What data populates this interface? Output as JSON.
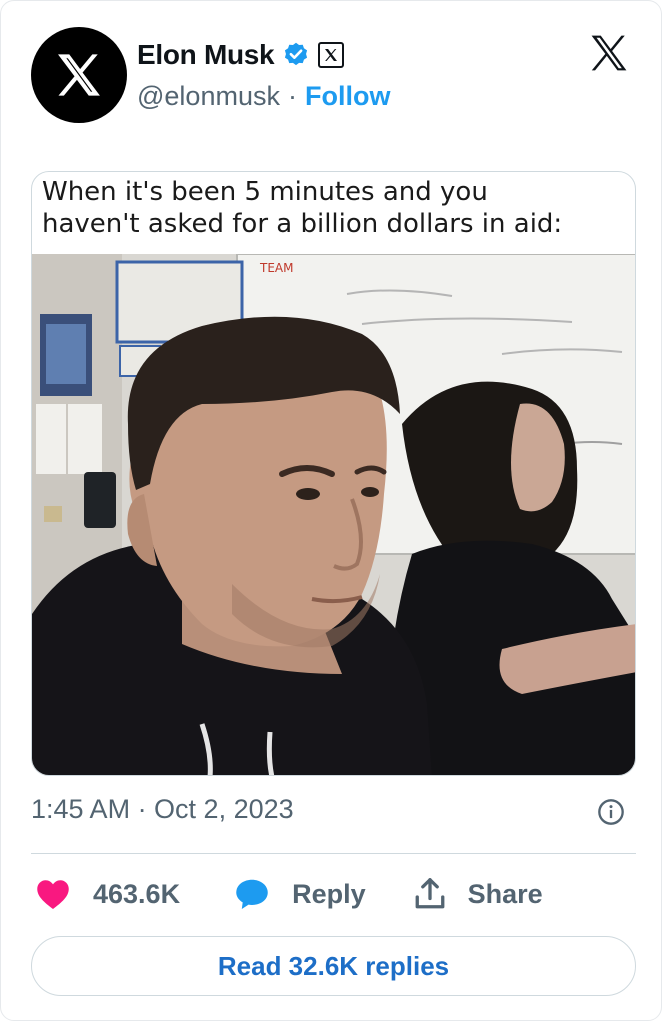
{
  "author": {
    "name": "Elon Musk",
    "handle": "@elonmusk",
    "separator": "·",
    "follow_label": "Follow",
    "avatar_icon": "x-logo-icon",
    "verified_icon": "verified-badge-icon",
    "affiliation_icon": "x-affiliation-icon"
  },
  "header": {
    "platform_icon": "x-logo-icon"
  },
  "media": {
    "caption_line1": "When it's been 5 minutes and you",
    "caption_line2": "haven't asked for a billion dollars in aid:",
    "image": "meme-photo"
  },
  "meta": {
    "timestamp": "1:45 AM · Oct 2, 2023",
    "info_icon": "info-icon"
  },
  "actions": {
    "like_count": "463.6K",
    "reply_label": "Reply",
    "share_label": "Share"
  },
  "read_replies_label": "Read 32.6K replies",
  "colors": {
    "accent": "#1d9bf0",
    "like": "#f91880",
    "reply": "#1d9bf0",
    "text_secondary": "#536471"
  }
}
